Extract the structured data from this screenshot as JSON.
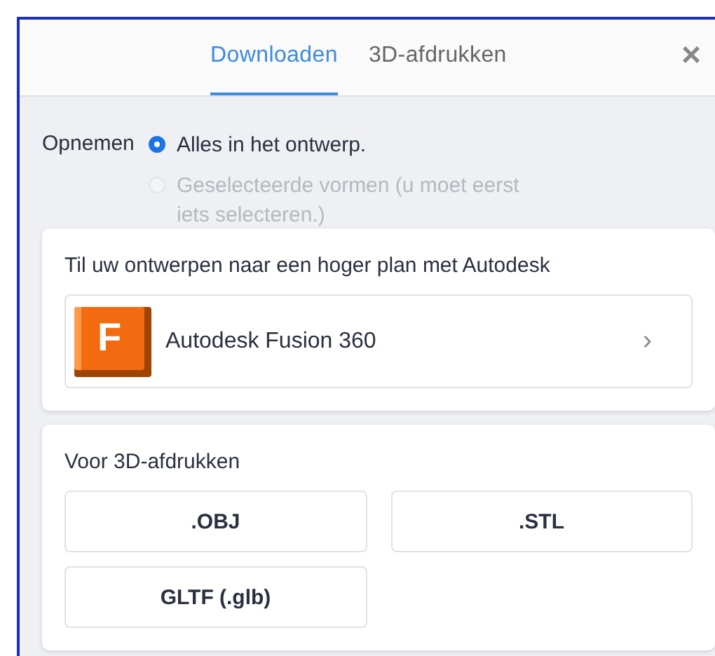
{
  "tabs": [
    {
      "label": "Downloaden",
      "selected": true
    },
    {
      "label": "3D-afdrukken",
      "selected": false
    }
  ],
  "close_label": "×",
  "include": {
    "label": "Opnemen",
    "options": [
      {
        "label": "Alles in het ontwerp.",
        "selected": true,
        "disabled": false
      },
      {
        "label": "Geselecteerde vormen (u moet eerst iets selecteren.)",
        "selected": false,
        "disabled": true
      }
    ]
  },
  "upgrade_card": {
    "title": "Til uw ontwerpen naar een hoger plan met Autodesk",
    "product": {
      "logo_letter": "F",
      "name": "Autodesk Fusion 360",
      "arrow": "›"
    }
  },
  "print_card": {
    "title": "Voor 3D-afdrukken",
    "formats": [
      ".OBJ",
      ".STL",
      "GLTF (.glb)"
    ]
  }
}
